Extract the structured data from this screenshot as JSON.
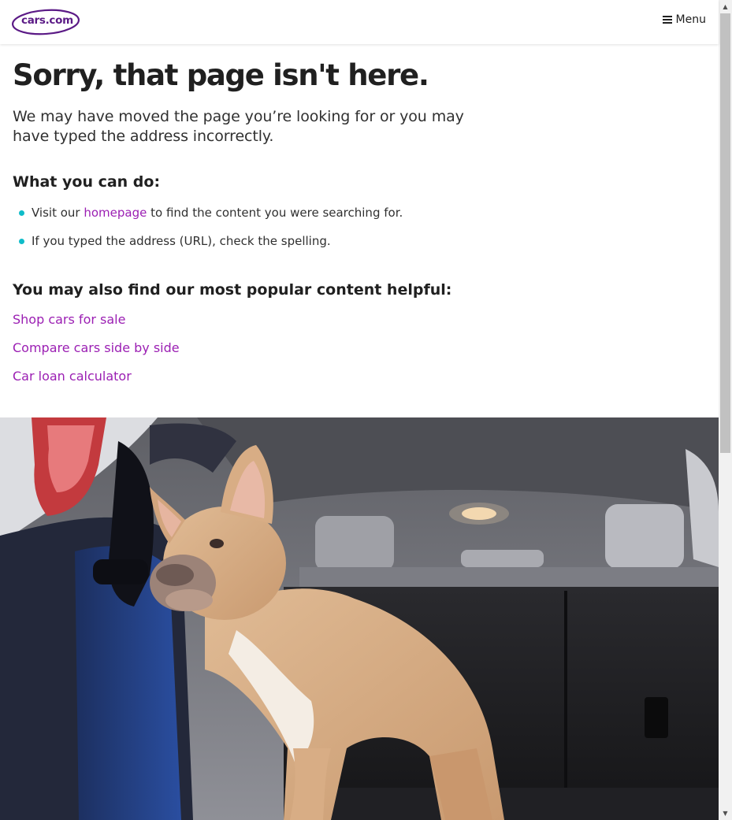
{
  "header": {
    "logo_text": "cars.com",
    "menu_label": "Menu"
  },
  "main": {
    "title": "Sorry, that page isn't here.",
    "lead": "We may have moved the page you’re looking for or you may have typed the address incorrectly.",
    "can_do_heading": "What you can do:",
    "bullet1_before": "Visit our ",
    "bullet1_link": "homepage",
    "bullet1_after": " to find the content you were searching for.",
    "bullet2": "If you typed the address (URL), check the spelling.",
    "popular_heading": "You may also find our most popular content helpful:",
    "links": [
      "Shop cars for sale",
      "Compare cars side by side",
      "Car loan calculator"
    ]
  },
  "colors": {
    "brand_purple": "#5b1a86",
    "link": "#9b1fb3",
    "bullet_dot": "#0fbcc9"
  },
  "icons": {
    "menu": "hamburger-icon",
    "scroll_up": "scroll-up-arrow-icon",
    "scroll_down": "scroll-down-arrow-icon"
  }
}
